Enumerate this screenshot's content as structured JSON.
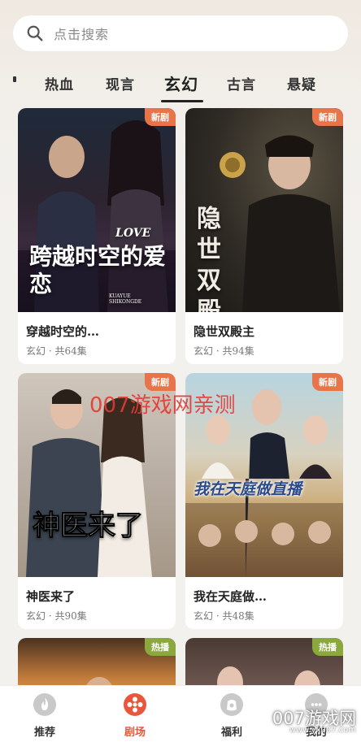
{
  "search": {
    "placeholder": "点击搜索"
  },
  "tabs": [
    {
      "label": "热血"
    },
    {
      "label": "现言"
    },
    {
      "label": "玄幻"
    },
    {
      "label": "古言"
    },
    {
      "label": "悬疑"
    }
  ],
  "active_tab": "玄幻",
  "cards": [
    {
      "title": "穿越时空的…",
      "meta": "玄幻 · 共64集",
      "badge": "新剧",
      "badge_color": "#e8744a",
      "poster_text": "跨越时空的爱恋",
      "poster_sub": "LOVE",
      "poster_caption": "KUAYUE SHIKONGDE"
    },
    {
      "title": "隐世双殿主",
      "meta": "玄幻 · 共94集",
      "badge": "新剧",
      "badge_color": "#e8744a",
      "poster_text": "隐世双殿主"
    },
    {
      "title": "神医来了",
      "meta": "玄幻 · 共90集",
      "badge": "新剧",
      "badge_color": "#e8744a",
      "poster_text": "神医来了"
    },
    {
      "title": "我在天庭做…",
      "meta": "玄幻 · 共48集",
      "badge": "新剧",
      "badge_color": "#e8744a",
      "poster_text": "我在天庭做直播"
    },
    {
      "badge": "热播",
      "badge_color": "#8aa83c"
    },
    {
      "badge": "热播",
      "badge_color": "#8aa83c"
    }
  ],
  "watermark": "007游戏网亲测",
  "bottom_nav": [
    {
      "label": "推荐",
      "icon": "flame-icon"
    },
    {
      "label": "剧场",
      "icon": "film-reel-icon"
    },
    {
      "label": "福利",
      "icon": "gift-bag-icon"
    },
    {
      "label": "我的",
      "icon": "chat-bubble-icon"
    }
  ],
  "active_nav": "剧场",
  "bottom_watermark": "007游戏网",
  "bottom_watermark_url": "www.yx007.com"
}
